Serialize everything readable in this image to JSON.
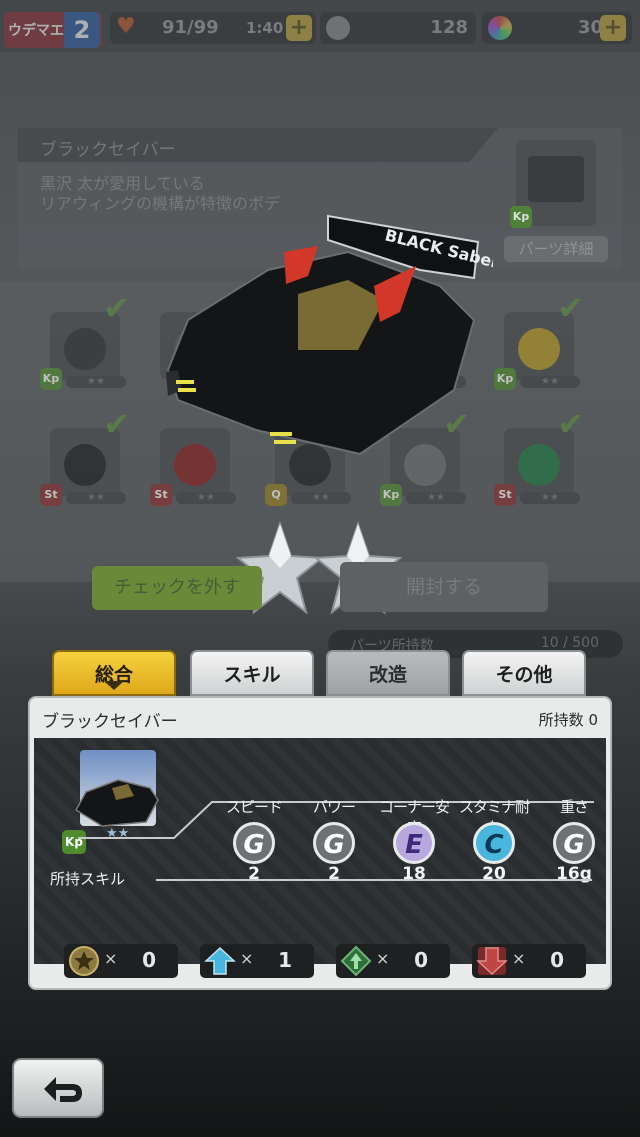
{
  "status_bar": {
    "rank_label": "ウデマエ",
    "rank_value": "2",
    "stamina": "91/99",
    "stamina_timer": "1:40",
    "plus": "+",
    "currency_a": "128",
    "currency_b": "30"
  },
  "part_info": {
    "title": "ブラックセイバー",
    "description_line1": "黒沢 太が愛用している",
    "description_line2": "リアウィングの機構が特徴のボデ",
    "detail_button": "パーツ詳細"
  },
  "parts_grid": [
    {
      "badge": "Kp",
      "badge_color": "#4e8c2e",
      "checked": true,
      "color": "#2b2d2f"
    },
    {
      "badge": "",
      "badge_color": "",
      "checked": true,
      "color": "#555"
    },
    {
      "badge": "",
      "badge_color": "",
      "checked": false,
      "color": "#555"
    },
    {
      "badge": "",
      "badge_color": "",
      "checked": false,
      "color": "#555"
    },
    {
      "badge": "Kp",
      "badge_color": "#4e8c2e",
      "checked": true,
      "color": "#b79a1f"
    },
    {
      "badge": "St",
      "badge_color": "#8c2e2e",
      "checked": true,
      "color": "#1b1c1d"
    },
    {
      "badge": "St",
      "badge_color": "#8c2e2e",
      "checked": false,
      "color": "#8a1c1c"
    },
    {
      "badge": "Q",
      "badge_color": "#9a7f1e",
      "checked": false,
      "color": "#1b1c1d"
    },
    {
      "badge": "Kp",
      "badge_color": "#4e8c2e",
      "checked": true,
      "color": "#6b6f72"
    },
    {
      "badge": "St",
      "badge_color": "#8c2e2e",
      "checked": true,
      "color": "#1d7a42"
    }
  ],
  "actions": {
    "uncheck": "チェックを外す",
    "open": "開封する",
    "owned_parts_label": "パーツ所持数",
    "owned_parts_value": "10 / 500"
  },
  "car_reveal": {
    "rarity_stars": 2,
    "body_text": "BLACK Saber"
  },
  "tabs": [
    {
      "label": "総合",
      "state": "active"
    },
    {
      "label": "スキル",
      "state": "idle"
    },
    {
      "label": "改造",
      "state": "dim"
    },
    {
      "label": "その他",
      "state": "idle"
    }
  ],
  "detail": {
    "name": "ブラックセイバー",
    "owned_label": "所持数",
    "owned_value": "0",
    "thumb_badge": "Kp",
    "stats": [
      {
        "label": "スピード",
        "grade": "G",
        "value": "2",
        "fill": "#6d7174",
        "text": "#ffffff"
      },
      {
        "label": "パワー",
        "grade": "G",
        "value": "2",
        "fill": "#6d7174",
        "text": "#ffffff"
      },
      {
        "label": "コーナー安定",
        "grade": "E",
        "value": "18",
        "fill": "#b7a8df",
        "text": "#3d2a7a"
      },
      {
        "label": "スタミナ耐久",
        "grade": "C",
        "value": "20",
        "fill": "#49b6de",
        "text": "#0d3b57"
      },
      {
        "label": "重さ",
        "grade": "G",
        "value": "16g",
        "fill": "#6d7174",
        "text": "#ffffff"
      }
    ],
    "skills_label": "所持スキル",
    "skills": [
      {
        "icon": "star-skill-icon",
        "times": "×",
        "count": "0"
      },
      {
        "icon": "up-arrow-skill-icon",
        "times": "×",
        "count": "1"
      },
      {
        "icon": "diamond-arrow-skill-icon",
        "times": "×",
        "count": "0"
      },
      {
        "icon": "down-arrow-skill-icon",
        "times": "×",
        "count": "0"
      }
    ]
  }
}
